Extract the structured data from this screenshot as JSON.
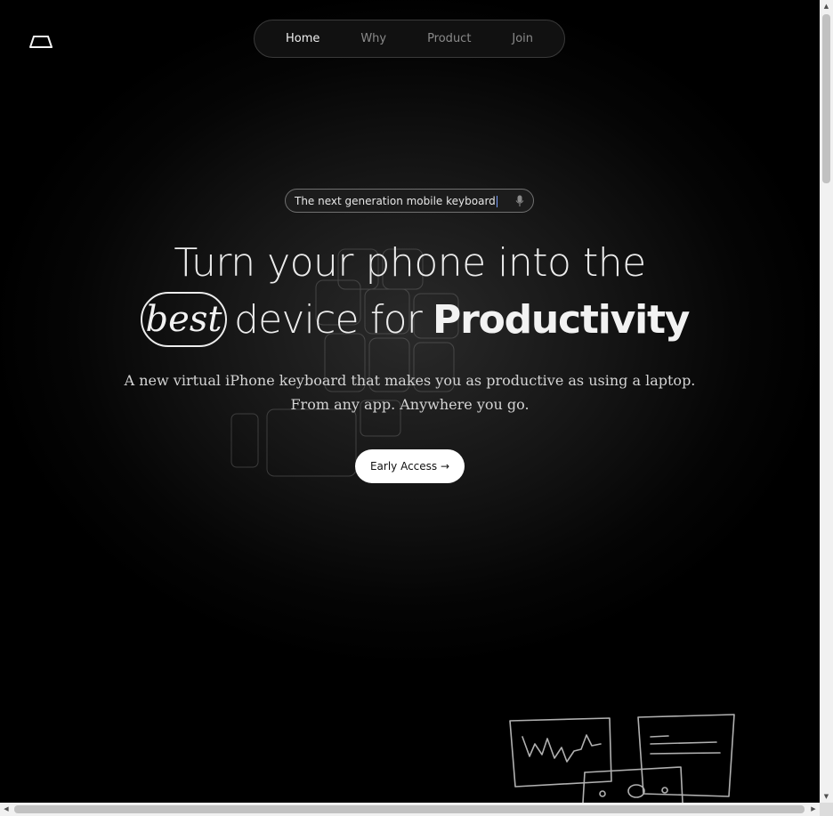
{
  "nav": {
    "items": [
      {
        "label": "Home",
        "active": true
      },
      {
        "label": "Why",
        "active": false
      },
      {
        "label": "Product",
        "active": false
      },
      {
        "label": "Join",
        "active": false
      }
    ]
  },
  "hero": {
    "input_text": "The next generation mobile keyboard",
    "headline_line1": "Turn your phone into the",
    "headline_badge": "best",
    "headline_light": "device for",
    "headline_bold": "Productivity",
    "subtitle_line1": "A new virtual iPhone keyboard that makes you as productive as using a laptop.",
    "subtitle_line2": "From any app. Anywhere you go.",
    "cta_label": "Early Access →"
  },
  "icons": {
    "logo": "laptop-trapezoid-logo",
    "mic": "microphone-icon"
  },
  "colors": {
    "background": "#000000",
    "text": "#ececec",
    "cta_bg": "#ffffff",
    "caret": "#7aa0ff"
  }
}
